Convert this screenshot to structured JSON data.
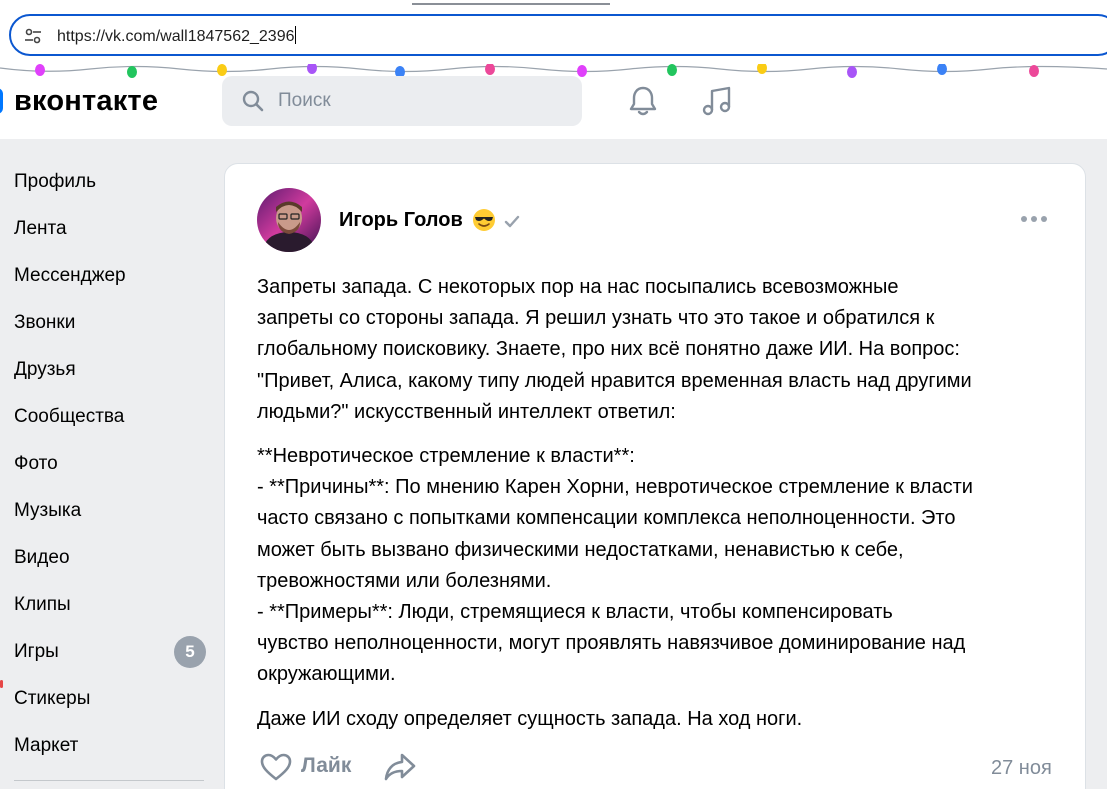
{
  "browser": {
    "url": "https://vk.com/wall1847562_2396"
  },
  "header": {
    "logo_text": "вконтакте",
    "search_placeholder": "Поиск",
    "icons": [
      "bell-icon",
      "music-icon"
    ],
    "garland_colors": [
      "#e040fb",
      "#22c55e",
      "#facc15",
      "#a855f7",
      "#3b82f6",
      "#ec4899"
    ]
  },
  "sidebar": {
    "items": [
      {
        "label": "Профиль"
      },
      {
        "label": "Лента"
      },
      {
        "label": "Мессенджер"
      },
      {
        "label": "Звонки"
      },
      {
        "label": "Друзья"
      },
      {
        "label": "Сообщества"
      },
      {
        "label": "Фото"
      },
      {
        "label": "Музыка"
      },
      {
        "label": "Видео"
      },
      {
        "label": "Клипы"
      },
      {
        "label": "Игры",
        "badge": "5"
      },
      {
        "label": "Стикеры"
      },
      {
        "label": "Маркет"
      }
    ]
  },
  "post": {
    "author": "Игорь Голов",
    "author_emoji": "sunglasses-emoji",
    "paragraphs": [
      [
        "Запреты запада. С некоторых пор на нас посыпались всевозможные",
        "запреты со стороны запада. Я решил узнать что это такое и обратился к",
        "глобальному поисковику. Знаете, про них всё понятно даже ИИ. На вопрос:",
        "\"Привет, Алиса, какому типу людей нравится временная власть над другими",
        "людьми?\" искусственный интеллект ответил:"
      ],
      [
        "**Невротическое стремление к власти**:",
        "- **Причины**: По мнению Карен Хорни, невротическое стремление к власти",
        "часто связано с попытками компенсации комплекса неполноценности. Это",
        "может быть вызвано физическими недостатками, ненавистью к себе,",
        "тревожностями или болезнями.",
        "- **Примеры**: Люди, стремящиеся к власти, чтобы компенсировать",
        "чувство неполноценности, могут проявлять навязчивое доминирование над",
        "окружающими."
      ],
      [
        "Даже ИИ сходу определяет сущность запада. На ход ноги."
      ]
    ],
    "like_label": "Лайк",
    "date": "27 ноя"
  },
  "colors": {
    "accent": "#0077ff",
    "muted": "#818c99",
    "background": "#edeef0",
    "badge": "#99a2ad"
  }
}
